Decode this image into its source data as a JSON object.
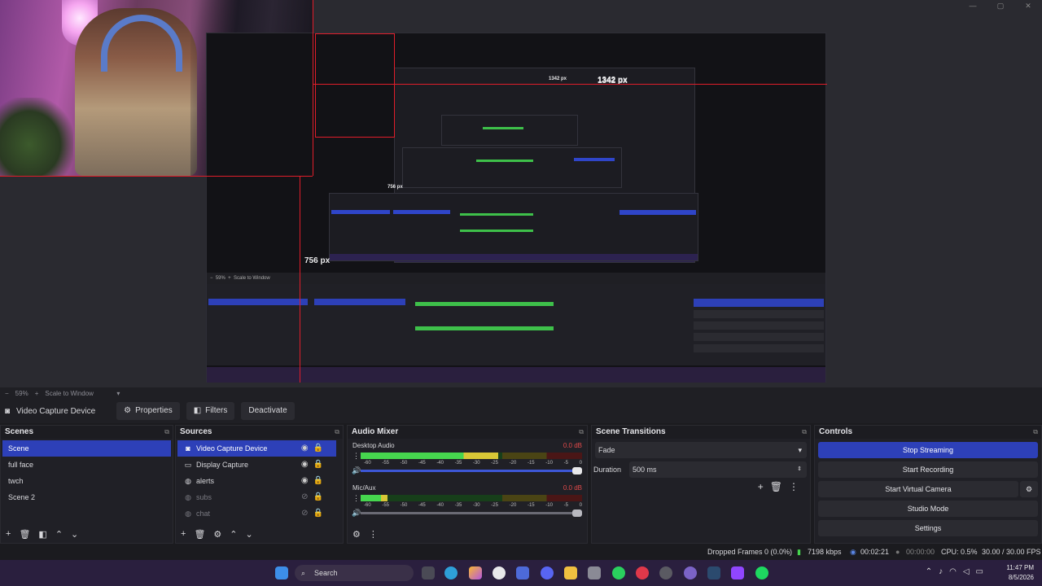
{
  "window_controls": [
    "—",
    "▢",
    "✕"
  ],
  "preview": {
    "dim_width": "1342 px",
    "dim_height": "756 px",
    "nested_width": "1342 px",
    "nested_height": "756 px"
  },
  "zoom": {
    "minus": "−",
    "level": "59%",
    "plus": "+",
    "mode": "Scale to Window"
  },
  "source_toolbar": {
    "source_name": "Video Capture Device",
    "properties": "Properties",
    "filters": "Filters",
    "deactivate": "Deactivate"
  },
  "scenes": {
    "title": "Scenes",
    "items": [
      "Scene",
      "full face",
      "twch",
      "Scene 2"
    ],
    "selected": 0
  },
  "sources": {
    "title": "Sources",
    "items": [
      {
        "name": "Video Capture Device",
        "icon": "camera-icon",
        "visible": true
      },
      {
        "name": "Display Capture",
        "icon": "monitor-icon",
        "visible": true
      },
      {
        "name": "alerts",
        "icon": "globe-icon",
        "visible": true
      },
      {
        "name": "subs",
        "icon": "globe-icon",
        "visible": false
      },
      {
        "name": "chat",
        "icon": "globe-icon",
        "visible": false
      }
    ]
  },
  "audio_mixer": {
    "title": "Audio Mixer",
    "tracks": [
      {
        "name": "Desktop Audio",
        "db": "0.0 dB",
        "level": 0.62,
        "volume": 1.0
      },
      {
        "name": "Mic/Aux",
        "db": "0.0 dB",
        "level": 0.12,
        "volume": 1.0
      }
    ],
    "ticks": [
      "-60",
      "-55",
      "-50",
      "-45",
      "-40",
      "-35",
      "-30",
      "-25",
      "-20",
      "-15",
      "-10",
      "-5",
      "0"
    ]
  },
  "transitions": {
    "title": "Scene Transitions",
    "type": "Fade",
    "duration_label": "Duration",
    "duration_value": "500 ms"
  },
  "controls": {
    "title": "Controls",
    "stop_streaming": "Stop Streaming",
    "start_recording": "Start Recording",
    "start_virtual_camera": "Start Virtual Camera",
    "studio_mode": "Studio Mode",
    "settings": "Settings"
  },
  "status": {
    "dropped": "Dropped Frames 0 (0.0%)",
    "bitrate": "7198 kbps",
    "stream_time": "00:02:21",
    "rec_time": "00:00:00",
    "cpu": "CPU: 0.5%",
    "fps": "30.00 / 30.00 FPS"
  },
  "taskbar": {
    "search": "Search",
    "time": "11:47 PM",
    "date": "8/5/2026"
  },
  "colors": {
    "accent": "#2d40b8",
    "red_guide": "#e11d2a",
    "taskbar": "#2a1f3e"
  }
}
